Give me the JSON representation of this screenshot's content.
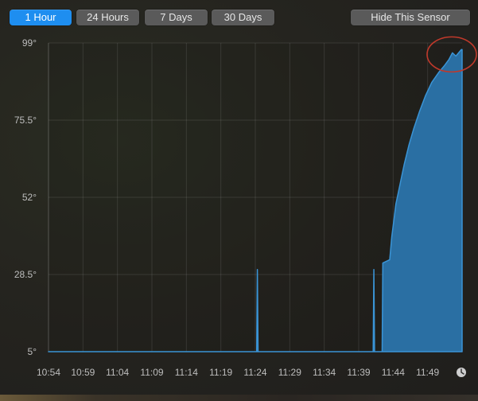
{
  "toolbar": {
    "ranges": [
      {
        "label": "1 Hour",
        "active": true
      },
      {
        "label": "24 Hours",
        "active": false
      },
      {
        "label": "7 Days",
        "active": false
      },
      {
        "label": "30 Days",
        "active": false
      }
    ],
    "hide_label": "Hide This Sensor"
  },
  "colors": {
    "accent": "#1e8ef0",
    "series_fill": "#2a6fa3",
    "series_line": "#3a94d6",
    "highlight_circle": "#c0392b"
  },
  "icons": {
    "clock": "clock-icon"
  },
  "chart_data": {
    "type": "area",
    "title": "",
    "xlabel": "",
    "ylabel": "",
    "yticks": [
      "5°",
      "28.5°",
      "52°",
      "75.5°",
      "99°"
    ],
    "ylim": [
      5,
      99
    ],
    "xticks": [
      "10:54",
      "10:59",
      "11:04",
      "11:09",
      "11:14",
      "11:19",
      "11:24",
      "11:29",
      "11:34",
      "11:39",
      "11:44",
      "11:49"
    ],
    "xlim_minutes": [
      0,
      60
    ],
    "grid": true,
    "series": [
      {
        "points": [
          [
            0,
            5
          ],
          [
            30.2,
            5
          ],
          [
            30.3,
            30
          ],
          [
            30.4,
            5
          ],
          [
            47.1,
            5
          ],
          [
            47.2,
            30
          ],
          [
            47.3,
            5
          ],
          [
            48.4,
            5
          ],
          [
            48.5,
            32
          ],
          [
            49.5,
            33
          ],
          [
            49.8,
            40
          ],
          [
            50.4,
            50
          ],
          [
            51,
            56
          ],
          [
            51.6,
            62
          ],
          [
            52.3,
            68
          ],
          [
            53,
            73
          ],
          [
            53.8,
            78
          ],
          [
            54.7,
            83
          ],
          [
            55.6,
            87
          ],
          [
            56.6,
            90
          ],
          [
            57.4,
            92
          ],
          [
            58.1,
            94
          ],
          [
            58.6,
            96
          ],
          [
            59.1,
            95
          ],
          [
            59.5,
            96
          ],
          [
            59.9,
            97
          ],
          [
            60,
            97
          ]
        ]
      }
    ],
    "annotation": {
      "type": "circle",
      "at_minutes": 58.5,
      "at_value": 96
    }
  }
}
